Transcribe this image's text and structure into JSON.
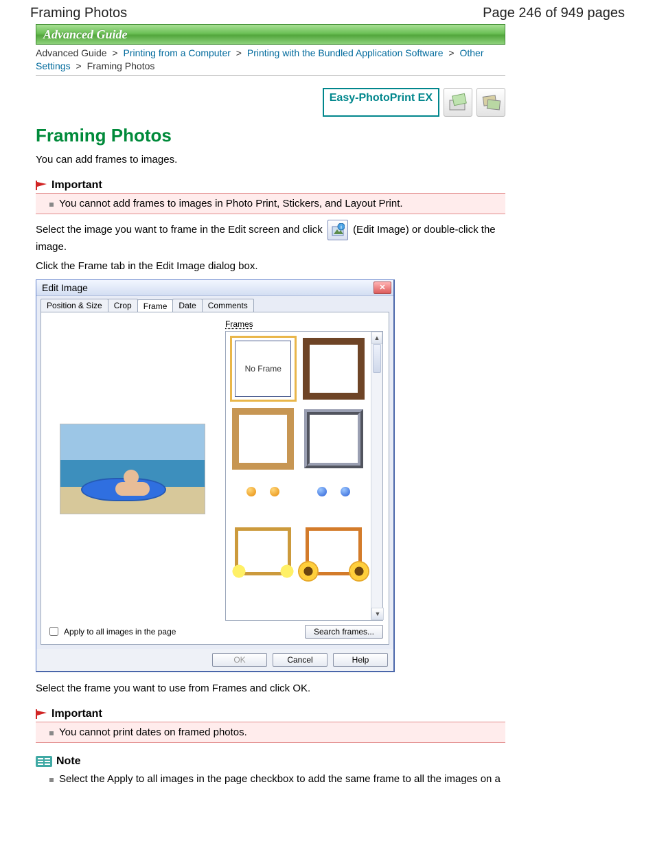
{
  "header": {
    "title": "Framing Photos",
    "page_position": "Page 246 of 949 pages"
  },
  "banner": {
    "text": "Advanced Guide"
  },
  "breadcrumb": {
    "items": [
      {
        "label": "Advanced Guide",
        "link": true
      },
      {
        "label": "Printing from a Computer",
        "link": true
      },
      {
        "label": "Printing with the Bundled Application Software",
        "link": true
      },
      {
        "label": "Other Settings",
        "link": true
      },
      {
        "label": "Framing Photos",
        "link": false
      }
    ],
    "sep": ">"
  },
  "app": {
    "name": "Easy-PhotoPrint EX"
  },
  "page": {
    "h1": "Framing Photos",
    "intro": "You can add frames to images.",
    "important_label": "Important",
    "important1": "You cannot add frames to images in Photo Print, Stickers, and Layout Print.",
    "select_prefix": "Select the image you want to frame in the Edit screen and click",
    "select_suffix": "(Edit Image) or double-click the image.",
    "click_frame_tab": "Click the Frame tab in the Edit Image dialog box.",
    "after_dialog": "Select the frame you want to use from Frames and click OK.",
    "important2": "You cannot print dates on framed photos.",
    "note_label": "Note",
    "note1": "Select the Apply to all images in the page checkbox to add the same frame to all the images on a"
  },
  "dialog": {
    "title": "Edit Image",
    "tabs": [
      "Position & Size",
      "Crop",
      "Frame",
      "Date",
      "Comments"
    ],
    "active_tab_index": 2,
    "frames_label": "Frames",
    "no_frame_label": "No Frame",
    "apply_all_label": "Apply to all images in the page",
    "search_frames_label": "Search frames...",
    "ok": "OK",
    "cancel": "Cancel",
    "help": "Help"
  }
}
